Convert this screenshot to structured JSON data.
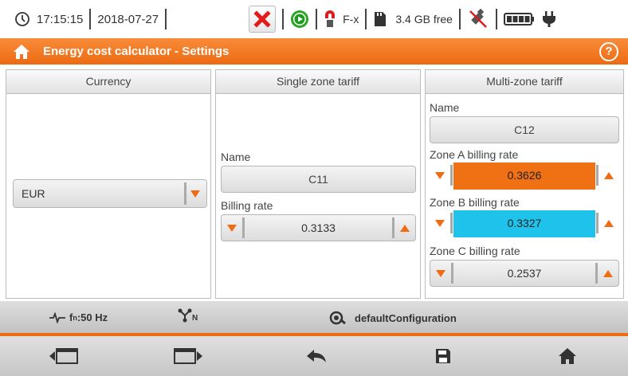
{
  "status": {
    "time": "17:15:15",
    "date": "2018-07-27",
    "clamp_label": "F-x",
    "storage": "3.4 GB free"
  },
  "header": {
    "title": "Energy cost calculator - Settings"
  },
  "currency": {
    "heading": "Currency",
    "value": "EUR"
  },
  "single": {
    "heading": "Single zone tariff",
    "name_label": "Name",
    "name_value": "C11",
    "rate_label": "Billing rate",
    "rate_value": "0.3133"
  },
  "multi": {
    "heading": "Multi-zone tariff",
    "name_label": "Name",
    "name_value": "C12",
    "zone_a_label": "Zone A billing rate",
    "zone_a_value": "0.3626",
    "zone_a_color": "#f07014",
    "zone_b_label": "Zone B billing rate",
    "zone_b_value": "0.3327",
    "zone_b_color": "#1ec2ea",
    "zone_c_label": "Zone C billing rate",
    "zone_c_value": "0.2537"
  },
  "info": {
    "frequency_prefix": "f",
    "frequency_sub": "n",
    "frequency_value": ":50 Hz",
    "network_sub": "N",
    "config": "defaultConfiguration"
  },
  "icons": {
    "accent": "#ef6c13"
  }
}
